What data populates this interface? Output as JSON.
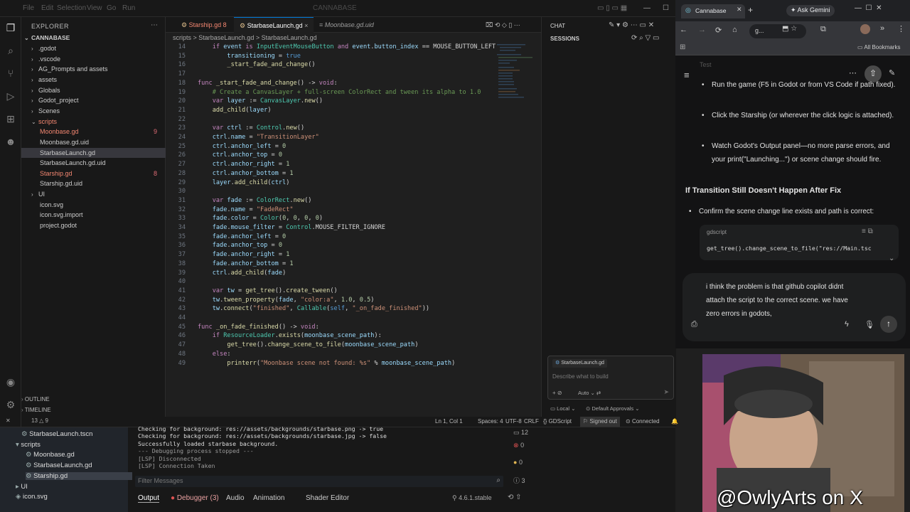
{
  "vscode": {
    "title": "CANNABASE",
    "menu": [
      "File",
      "Edit",
      "Selection",
      "View",
      "Go",
      "Run"
    ],
    "explorer_title": "EXPLORER",
    "project": "CANNABASE",
    "tree": [
      {
        "label": ".godot",
        "type": "folder"
      },
      {
        "label": ".vscode",
        "type": "folder"
      },
      {
        "label": "AG_Prompts and assets",
        "type": "folder"
      },
      {
        "label": "assets",
        "type": "folder"
      },
      {
        "label": "Globals",
        "type": "folder"
      },
      {
        "label": "Godot_project",
        "type": "folder"
      },
      {
        "label": "Scenes",
        "type": "folder"
      },
      {
        "label": "scripts",
        "type": "folder-open",
        "color": "#f48771"
      },
      {
        "label": "Moonbase.gd",
        "type": "file",
        "color": "#f48771",
        "badge": "9"
      },
      {
        "label": "Moonbase.gd.uid",
        "type": "file"
      },
      {
        "label": "StarbaseLaunch.gd",
        "type": "file",
        "selected": true
      },
      {
        "label": "StarbaseLaunch.gd.uid",
        "type": "file"
      },
      {
        "label": "Starship.gd",
        "type": "file",
        "color": "#f48771",
        "badge": "8"
      },
      {
        "label": "Starship.gd.uid",
        "type": "file"
      },
      {
        "label": "UI",
        "type": "folder"
      },
      {
        "label": "icon.svg",
        "type": "file"
      },
      {
        "label": "icon.svg.import",
        "type": "file"
      },
      {
        "label": "project.godot",
        "type": "file"
      }
    ],
    "outline_label": "OUTLINE",
    "timeline_label": "TIMELINE",
    "tabs": [
      {
        "label": "Starship.gd 8",
        "active": false,
        "error": true
      },
      {
        "label": "StarbaseLaunch.gd",
        "active": true
      },
      {
        "label": "Moonbase.gd.uid",
        "active": false
      }
    ],
    "breadcrumb": "scripts > StarbaseLaunch.gd > StarbaseLaunch.gd",
    "code": [
      {
        "n": "14",
        "t": "    if event is InputEventMouseButton and event.button_index == MOUSE_BUTTON_LEFT"
      },
      {
        "n": "15",
        "t": "        transitioning = true"
      },
      {
        "n": "16",
        "t": "        _start_fade_and_change()"
      },
      {
        "n": "17",
        "t": ""
      },
      {
        "n": "18",
        "t": "func _start_fade_and_change() -> void:"
      },
      {
        "n": "19",
        "t": "    # Create a CanvasLayer + full-screen ColorRect and tween its alpha to 1.0"
      },
      {
        "n": "20",
        "t": "    var layer := CanvasLayer.new()"
      },
      {
        "n": "21",
        "t": "    add_child(layer)"
      },
      {
        "n": "22",
        "t": ""
      },
      {
        "n": "23",
        "t": "    var ctrl := Control.new()"
      },
      {
        "n": "24",
        "t": "    ctrl.name = \"TransitionLayer\""
      },
      {
        "n": "25",
        "t": "    ctrl.anchor_left = 0"
      },
      {
        "n": "26",
        "t": "    ctrl.anchor_top = 0"
      },
      {
        "n": "27",
        "t": "    ctrl.anchor_right = 1"
      },
      {
        "n": "28",
        "t": "    ctrl.anchor_bottom = 1"
      },
      {
        "n": "29",
        "t": "    layer.add_child(ctrl)"
      },
      {
        "n": "30",
        "t": ""
      },
      {
        "n": "31",
        "t": "    var fade := ColorRect.new()"
      },
      {
        "n": "32",
        "t": "    fade.name = \"FadeRect\""
      },
      {
        "n": "33",
        "t": "    fade.color = Color(0, 0, 0, 0)"
      },
      {
        "n": "34",
        "t": "    fade.mouse_filter = Control.MOUSE_FILTER_IGNORE"
      },
      {
        "n": "35",
        "t": "    fade.anchor_left = 0"
      },
      {
        "n": "36",
        "t": "    fade.anchor_top = 0"
      },
      {
        "n": "37",
        "t": "    fade.anchor_right = 1"
      },
      {
        "n": "38",
        "t": "    fade.anchor_bottom = 1"
      },
      {
        "n": "39",
        "t": "    ctrl.add_child(fade)"
      },
      {
        "n": "40",
        "t": ""
      },
      {
        "n": "41",
        "t": "    var tw = get_tree().create_tween()"
      },
      {
        "n": "42",
        "t": "    tw.tween_property(fade, \"color:a\", 1.0, 0.5)"
      },
      {
        "n": "43",
        "t": "    tw.connect(\"finished\", Callable(self, \"_on_fade_finished\"))"
      },
      {
        "n": "44",
        "t": ""
      },
      {
        "n": "45",
        "t": "func _on_fade_finished() -> void:"
      },
      {
        "n": "46",
        "t": "    if ResourceLoader.exists(moonbase_scene_path):"
      },
      {
        "n": "47",
        "t": "        get_tree().change_scene_to_file(moonbase_scene_path)"
      },
      {
        "n": "48",
        "t": "    else:"
      },
      {
        "n": "49",
        "t": "        printerr(\"Moonbase scene not found: %s\" % moonbase_scene_path)"
      }
    ],
    "chat": {
      "title": "CHAT",
      "sessions": "SESSIONS",
      "context_chip": "StarbaseLaunch.gd",
      "placeholder": "Describe what to build",
      "mode": "Auto",
      "location": "Local",
      "approvals": "Default Approvals"
    },
    "status": {
      "position": "Ln 1, Col 1",
      "spaces": "Spaces: 4",
      "encoding": "UTF-8",
      "eol": "CRLF",
      "language": "GDScript",
      "signed": "Signed out",
      "connected": "Connected"
    },
    "godot": {
      "scene_tree": [
        "StarbaseLaunch.tscn",
        "scripts",
        "Moonbase.gd",
        "StarbaseLaunch.gd",
        "Starship.gd",
        "UI",
        "icon.svg"
      ],
      "output_lines": [
        "Checking for background: res://assets/backgrounds/starbase.png -> true",
        "Checking for background: res://assets/backgrounds/starbase.jpg -> false",
        "Successfully loaded starbase background.",
        "--- Debugging process stopped ---",
        "[LSP] Disconnected",
        "[LSP] Connection Taken"
      ],
      "filter_placeholder": "Filter Messages",
      "bottom_tabs": [
        "Output",
        "Debugger (3)",
        "Audio",
        "Animation",
        "Shader Editor"
      ],
      "version": "4.6.1.stable",
      "counters": [
        "12",
        "0",
        "0",
        "3"
      ],
      "left_counts": [
        "13",
        "9"
      ]
    }
  },
  "browser": {
    "tab_title": "Cannabase",
    "ask_gemini": "Ask Gemini",
    "address": "g...",
    "bookmarks": "All Bookmarks",
    "faded_header": "Test",
    "bullets": [
      "Run the game (F5 in Godot or from VS Code if path fixed).",
      "Click the Starship (or wherever the click logic is attached).",
      "Watch Godot's Output panel—no more parse errors, and your print(\"Launching...\") or scene change should fire."
    ],
    "heading": "If Transition Still Doesn't Happen After Fix",
    "bullet2": "Confirm the scene change line exists and path is correct:",
    "code_lang": "gdscript",
    "code": "get_tree().change_scene_to_file(\"res://Main.tsc",
    "input_text": "i think the problem is that github copilot didnt attach the script to the correct scene. we have zero errors in godots,"
  },
  "overlay": {
    "handle": "@OwlyArts on X"
  }
}
